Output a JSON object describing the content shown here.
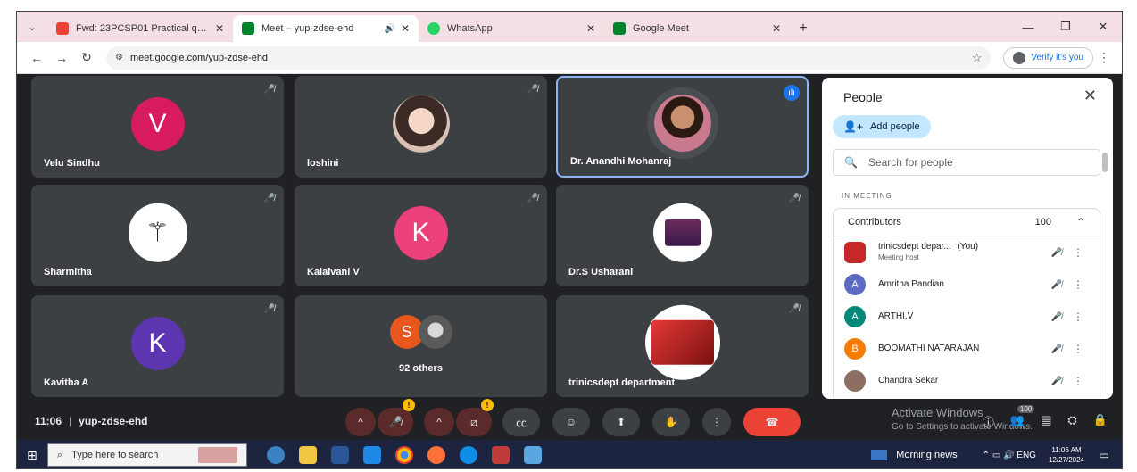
{
  "browser": {
    "tabs": [
      {
        "title": "Fwd: 23PCSP01 Practical questi…",
        "favicon_color": "#ea4335",
        "active": false
      },
      {
        "title": "Meet – yup-zdse-ehd",
        "favicon_color": "#00832d",
        "active": true
      },
      {
        "title": "WhatsApp",
        "favicon_color": "#25d366",
        "active": false
      },
      {
        "title": "Google Meet",
        "favicon_color": "#00832d",
        "active": false
      }
    ],
    "url": "meet.google.com/yup-zdse-ehd",
    "verify_label": "Verify it's you"
  },
  "participants": [
    {
      "name": "Velu Sindhu",
      "initial": "V",
      "avatar_color": "#d81b60"
    },
    {
      "name": "loshini",
      "initial": "",
      "avatar_color": "#c49a7a"
    },
    {
      "name": "Dr. Anandhi Mohanraj",
      "initial": "",
      "avatar_color": "#8d6e63"
    },
    {
      "name": "Sharmitha",
      "initial": "",
      "avatar_color": "#ffffff"
    },
    {
      "name": "Kalaivani V",
      "initial": "K",
      "avatar_color": "#ec407a"
    },
    {
      "name": "Dr.S Usharani",
      "initial": "",
      "avatar_color": "#ffffff"
    },
    {
      "name": "Kavitha A",
      "initial": "K",
      "avatar_color": "#5e35b1"
    },
    {
      "name": "92 others",
      "initial": "S",
      "avatar_color": "#e8581e"
    },
    {
      "name": "trinicsdept department",
      "initial": "",
      "avatar_color": "#c62828"
    }
  ],
  "people_panel": {
    "title": "People",
    "add_people": "Add people",
    "search_placeholder": "Search for people",
    "in_meeting_label": "IN MEETING",
    "section_label": "Contributors",
    "section_count": "100",
    "people": [
      {
        "name": "trinicsdept depar...",
        "you": "(You)",
        "sub": "Meeting host",
        "initial": "",
        "color": "#c62828"
      },
      {
        "name": "Amritha Pandian",
        "you": "",
        "sub": "",
        "initial": "A",
        "color": "#5c6bc0"
      },
      {
        "name": "ARTHI.V",
        "you": "",
        "sub": "",
        "initial": "A",
        "color": "#00897b"
      },
      {
        "name": "BOOMATHI NATARAJAN",
        "you": "",
        "sub": "",
        "initial": "B",
        "color": "#f57c00"
      },
      {
        "name": "Chandra Sekar",
        "you": "",
        "sub": "",
        "initial": "",
        "color": "#8d6e63"
      }
    ]
  },
  "meeting_bar": {
    "time": "11:06",
    "code": "yup-zdse-ehd",
    "participant_count": "100",
    "watermark_line1": "Activate Windows",
    "watermark_line2": "Go to Settings to activate Windows."
  },
  "taskbar": {
    "search_placeholder": "Type here to search",
    "news": "Morning news",
    "lang": "ENG",
    "time": "11:06 AM",
    "date": "12/27/2024"
  }
}
